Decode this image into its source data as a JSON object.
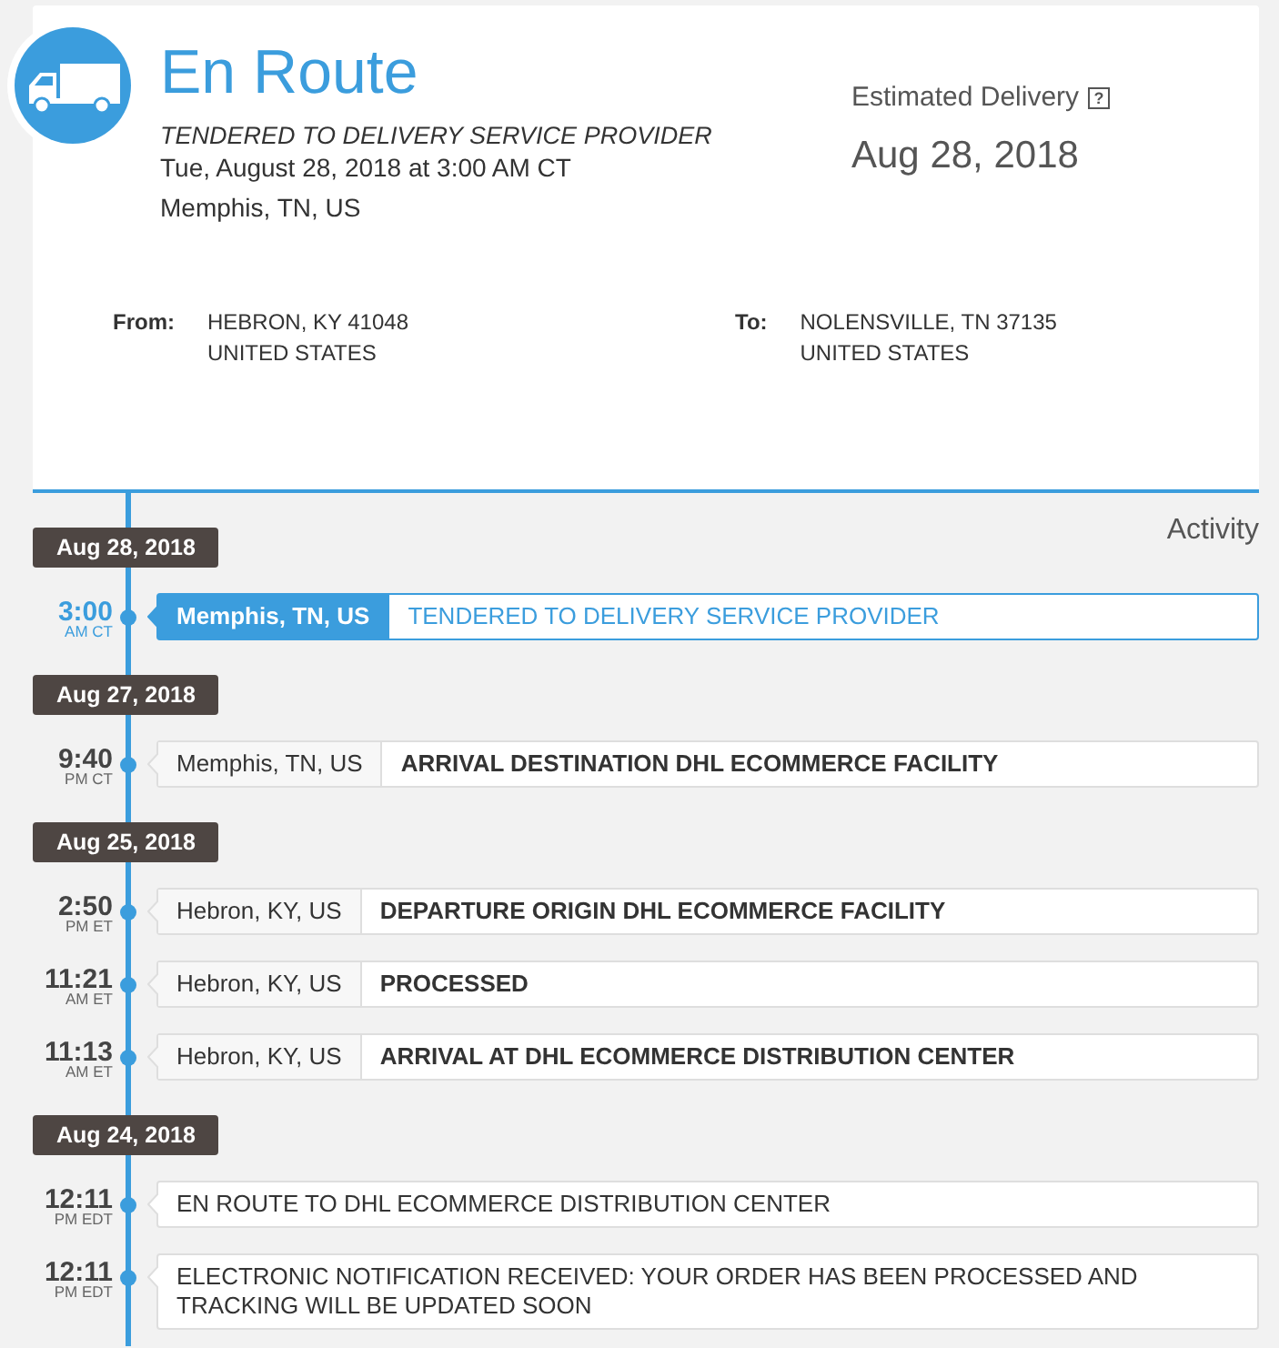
{
  "shipment": {
    "title": "En Route",
    "status": "TENDERED TO DELIVERY SERVICE PROVIDER",
    "datetime": "Tue, August 28, 2018 at 3:00 AM CT",
    "location": "Memphis, TN, US"
  },
  "estimated_delivery": {
    "label": "Estimated Delivery",
    "help": "?",
    "date": "Aug 28, 2018"
  },
  "addresses": [
    {
      "label": "From:",
      "lines": [
        "HEBRON, KY 41048",
        "UNITED STATES"
      ]
    },
    {
      "label": "To:",
      "lines": [
        "NOLENSVILLE, TN 37135",
        "UNITED STATES"
      ]
    }
  ],
  "activity": {
    "title": "Activity",
    "days": [
      {
        "date": "Aug 28, 2018",
        "events": [
          {
            "time": "3:00",
            "zone": "AM CT",
            "location": "Memphis, TN, US",
            "description": "TENDERED TO DELIVERY SERVICE PROVIDER",
            "current": true
          }
        ]
      },
      {
        "date": "Aug 27, 2018",
        "events": [
          {
            "time": "9:40",
            "zone": "PM CT",
            "location": "Memphis, TN, US",
            "description": "ARRIVAL DESTINATION DHL ECOMMERCE FACILITY",
            "current": false
          }
        ]
      },
      {
        "date": "Aug 25, 2018",
        "events": [
          {
            "time": "2:50",
            "zone": "PM ET",
            "location": "Hebron, KY, US",
            "description": "DEPARTURE ORIGIN DHL ECOMMERCE FACILITY",
            "current": false
          },
          {
            "time": "11:21",
            "zone": "AM ET",
            "location": "Hebron, KY, US",
            "description": "PROCESSED",
            "current": false
          },
          {
            "time": "11:13",
            "zone": "AM ET",
            "location": "Hebron, KY, US",
            "description": "ARRIVAL AT DHL ECOMMERCE DISTRIBUTION CENTER",
            "current": false
          }
        ]
      },
      {
        "date": "Aug 24, 2018",
        "events": [
          {
            "time": "12:11",
            "zone": "PM EDT",
            "description": "EN ROUTE TO DHL ECOMMERCE DISTRIBUTION CENTER",
            "current": false
          },
          {
            "time": "12:11",
            "zone": "PM EDT",
            "description": "ELECTRONIC NOTIFICATION RECEIVED: YOUR ORDER HAS BEEN PROCESSED AND TRACKING WILL BE UPDATED SOON",
            "current": false
          }
        ]
      }
    ]
  }
}
